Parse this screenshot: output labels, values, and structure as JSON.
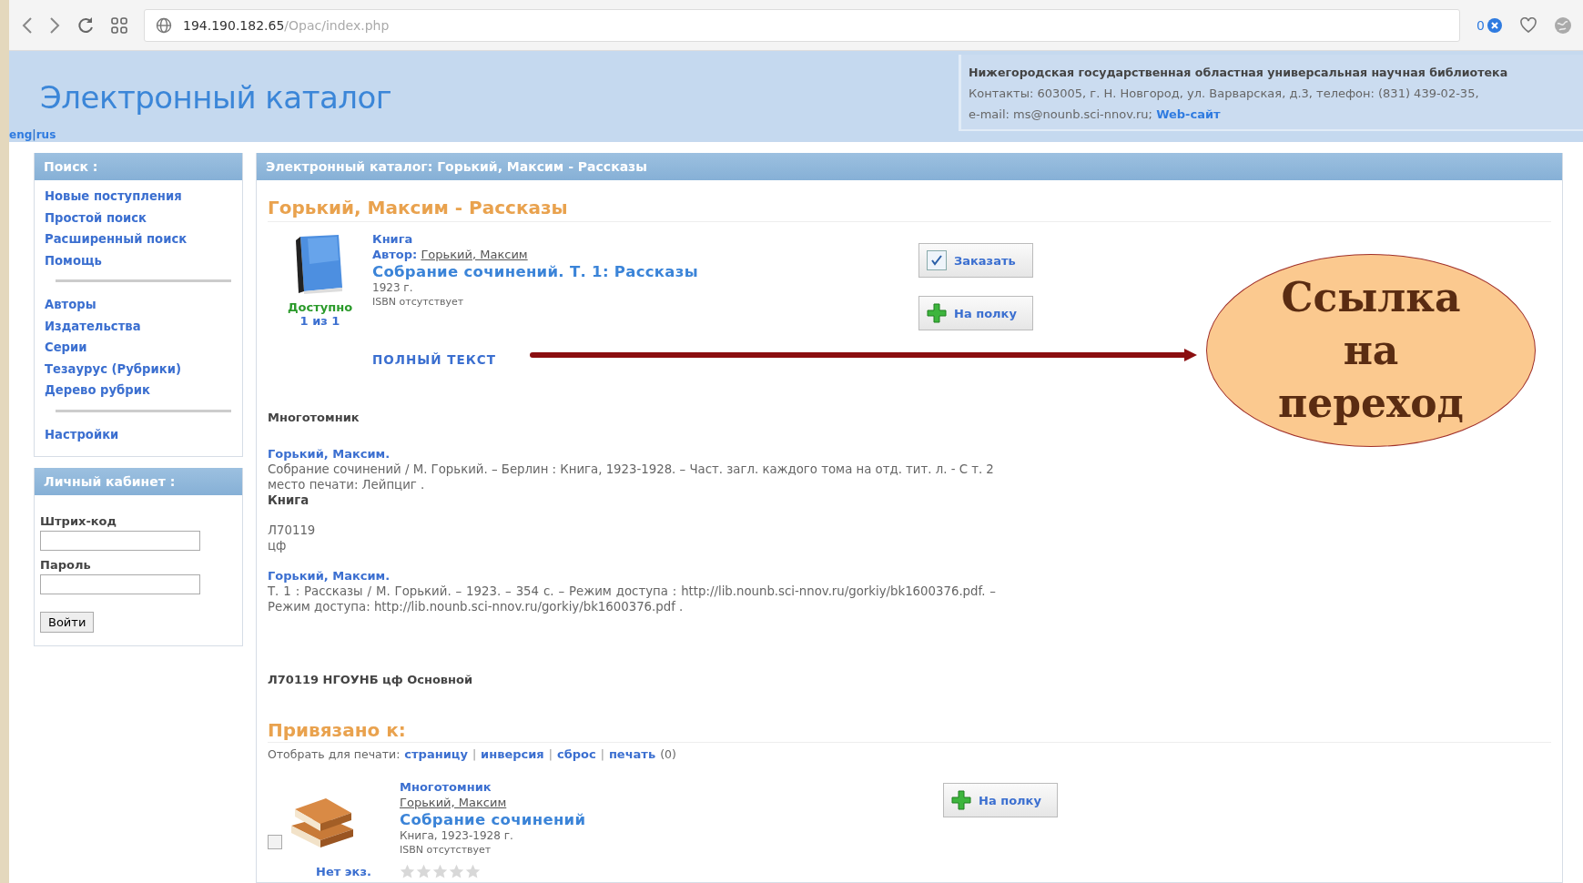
{
  "browser": {
    "address_host": "194.190.182.65",
    "address_path": "/Opac/index.php",
    "blocked_count": "0"
  },
  "header": {
    "title": "Электронный каталог",
    "language_links": [
      "eng",
      "rus"
    ],
    "language_separator": "|",
    "library": {
      "name": "Нижегородская государственная областная универсальная научная библиотека",
      "contacts": "Контакты: 603005, г. Н. Новгород, ул. Варварская, д.3, телефон: (831) 439-02-35,",
      "email": "e-mail: ms@nounb.sci-nnov.ru;",
      "website_link": "Web-сайт"
    }
  },
  "sidebar": {
    "search_panel": {
      "title": "Поиск :",
      "groups": [
        [
          "Новые поступления",
          "Простой поиск",
          "Расширенный поиск",
          "Помощь"
        ],
        [
          "Авторы",
          "Издательства",
          "Серии",
          "Тезаурус (Рубрики)",
          "Дерево рубрик"
        ],
        [
          "Настройки"
        ]
      ]
    },
    "cabinet_panel": {
      "title": "Личный кабинет :",
      "barcode_label": "Штрих-код",
      "password_label": "Пароль",
      "login_button": "Войти"
    }
  },
  "main": {
    "panel_title": "Электронный каталог: Горький, Максим - Рассказы",
    "heading": "Горький, Максим - Рассказы",
    "record": {
      "availability": "Доступно",
      "copies": "1 из 1",
      "type": "Книга",
      "author_label": "Автор:",
      "author": "Горький, Максим",
      "title": "Собрание сочинений. Т. 1: Рассказы",
      "year": "1923 г.",
      "isbn": "ISBN отсутствует",
      "order_button": "Заказать",
      "shelf_button": "На полку",
      "fulltext_link": "ПОЛНЫЙ ТЕКСТ"
    },
    "multivolume_label": "Многотомник",
    "description": [
      {
        "author": "Горький, Максим.",
        "text": "Собрание сочинений / М. Горький. – Берлин : Книга, 1923-1928. – Част. загл. каждого тома на отд. тит. л. - С т. 2 место печати: Лейпциг .",
        "type": "Книга",
        "lines": [
          "Л70119",
          "цф"
        ]
      },
      {
        "author": "Горький, Максим.",
        "text": "Т. 1 : Рассказы / М. Горький. – 1923. – 354 с. – Режим доступа : http://lib.nounb.sci-nnov.ru/gorkiy/bk1600376.pdf. – Режим доступа: http://lib.nounb.sci-nnov.ru/gorkiy/bk1600376.pdf ."
      }
    ],
    "holdings": "Л70119 НГОУНБ цф Основной",
    "bound": {
      "heading": "Привязано к:",
      "print_label": "Отобрать для печати:",
      "print_links": [
        "страницу",
        "инверсия",
        "сброс",
        "печать"
      ],
      "print_separator": "|",
      "print_count": "(0)",
      "items": [
        {
          "checked": false,
          "type": "Многотомник",
          "author": "Горький, Максим",
          "title": "Собрание сочинений",
          "info": "Книга, 1923-1928 г.",
          "isbn": "ISBN отсутствует",
          "availability": "Нет экз.",
          "stars": 0,
          "shelf_button": "На полку"
        }
      ]
    }
  },
  "callout": {
    "text": "Ссылка на переход"
  }
}
